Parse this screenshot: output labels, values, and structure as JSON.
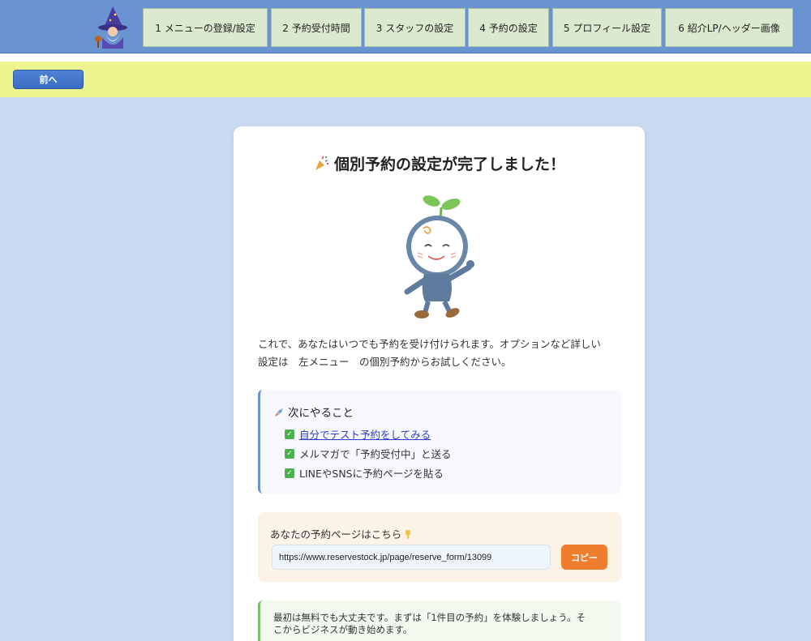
{
  "nav": {
    "steps": [
      {
        "label": "1 メニューの登録/設定"
      },
      {
        "label": "2 予約受付時間"
      },
      {
        "label": "3 スタッフの設定"
      },
      {
        "label": "4 予約の設定"
      },
      {
        "label": "5 プロフィール設定"
      },
      {
        "label": "6 紹介LP/ヘッダー画像"
      }
    ]
  },
  "toolbar": {
    "prev_label": "前へ"
  },
  "card": {
    "title": "個別予約の設定が完了しました！",
    "intro_line1": "これで、あなたはいつでも予約を受け付けられます。オプションなど詳しい",
    "intro_line2": "設定は　左メニュー　の個別予約からお試しください。",
    "next_title": "次にやること",
    "next_items": [
      {
        "label": "自分でテスト予約をしてみる"
      },
      {
        "label": "メルマガで「予約受付中」と送る"
      },
      {
        "label": "LINEやSNSに予約ページを貼る"
      }
    ],
    "url_label": "あなたの予約ページはこちら",
    "url_value": "https://www.reservestock.jp/page/reserve_form/13099",
    "copy_label": "コピー",
    "note_line1": "最初は無料でも大丈夫です。まずは「1件目の予約」を体験しましょう。そ",
    "note_line2": "こからビジネスが動き始めます。"
  },
  "colors": {
    "topbar": "#6a93d2",
    "tab_bg": "#dbe9cf",
    "yellowbar": "#eef58f",
    "page_bg": "#c9dbf0",
    "copy_button": "#ef7d2e"
  },
  "icons": {
    "title": "party-popper-icon",
    "next": "rocket-icon",
    "check": "check-mark-icon",
    "url": "pointing-down-icon"
  }
}
